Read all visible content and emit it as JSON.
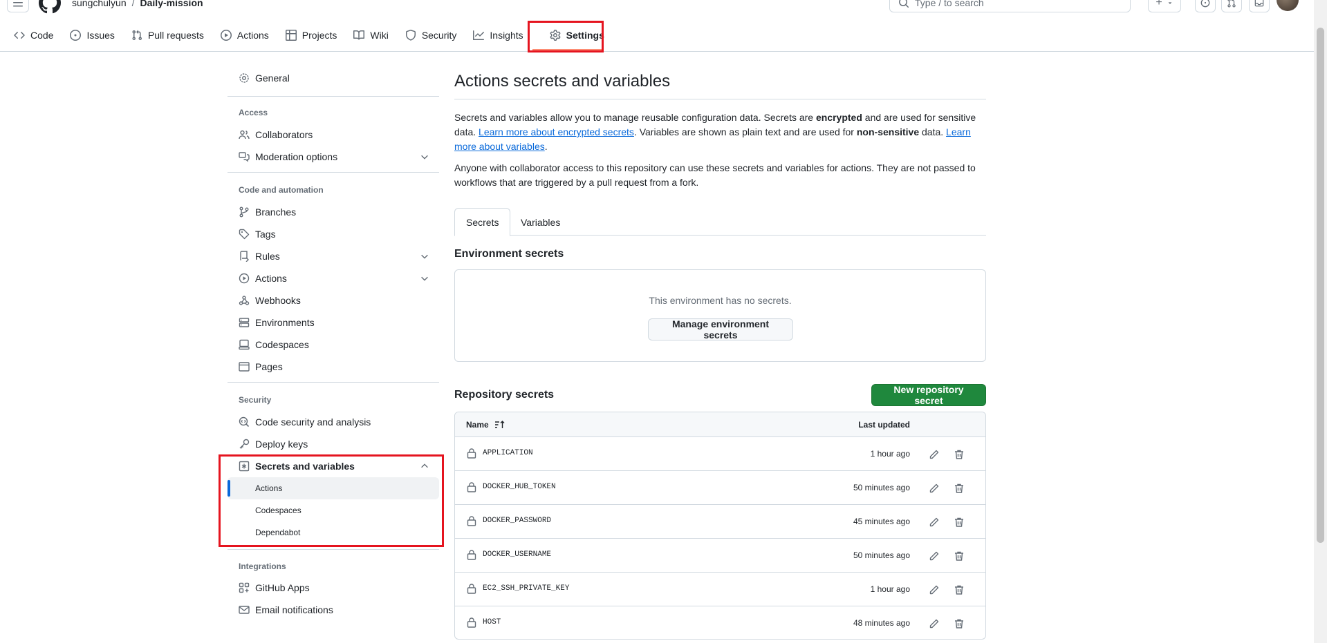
{
  "header": {
    "owner": "sungchulyun",
    "separator": "/",
    "repo": "Daily-mission",
    "search_placeholder": "Type / to search",
    "plus_label": "+"
  },
  "repo_nav": {
    "items": [
      {
        "label": "Code",
        "icon": "code-icon"
      },
      {
        "label": "Issues",
        "icon": "issue-icon"
      },
      {
        "label": "Pull requests",
        "icon": "pull-request-icon"
      },
      {
        "label": "Actions",
        "icon": "play-icon"
      },
      {
        "label": "Projects",
        "icon": "table-icon"
      },
      {
        "label": "Wiki",
        "icon": "book-icon"
      },
      {
        "label": "Security",
        "icon": "shield-icon"
      },
      {
        "label": "Insights",
        "icon": "graph-icon"
      },
      {
        "label": "Settings",
        "icon": "gear-icon"
      }
    ],
    "active": "Settings"
  },
  "sidebar": {
    "general": "General",
    "access_heading": "Access",
    "collaborators": "Collaborators",
    "moderation": "Moderation options",
    "code_heading": "Code and automation",
    "branches": "Branches",
    "tags": "Tags",
    "rules": "Rules",
    "actions": "Actions",
    "webhooks": "Webhooks",
    "environments": "Environments",
    "codespaces": "Codespaces",
    "pages": "Pages",
    "security_heading": "Security",
    "code_security": "Code security and analysis",
    "deploy_keys": "Deploy keys",
    "secrets_vars": "Secrets and variables",
    "sub_actions": "Actions",
    "sub_codespaces": "Codespaces",
    "sub_dependabot": "Dependabot",
    "integrations_heading": "Integrations",
    "github_apps": "GitHub Apps",
    "email_notifications": "Email notifications"
  },
  "main": {
    "title": "Actions secrets and variables",
    "p1": {
      "a": "Secrets and variables allow you to manage reusable configuration data. Secrets are ",
      "b": "encrypted",
      "c": " and are used for sensitive data. ",
      "link1": "Learn more about encrypted secrets",
      "d": ". Variables are shown as plain text and are used for ",
      "e": "non-sensitive",
      "f": " data. ",
      "link2": "Learn more about variables",
      "g": "."
    },
    "p2": "Anyone with collaborator access to this repository can use these secrets and variables for actions. They are not passed to workflows that are triggered by a pull request from a fork.",
    "tab_secrets": "Secrets",
    "tab_variables": "Variables",
    "env_heading": "Environment secrets",
    "env_empty": "This environment has no secrets.",
    "env_button": "Manage environment secrets",
    "repo_heading": "Repository secrets",
    "new_secret_button": "New repository secret",
    "col_name": "Name",
    "col_updated": "Last updated",
    "secrets": [
      {
        "name": "APPLICATION",
        "updated": "1 hour ago"
      },
      {
        "name": "DOCKER_HUB_TOKEN",
        "updated": "50 minutes ago"
      },
      {
        "name": "DOCKER_PASSWORD",
        "updated": "45 minutes ago"
      },
      {
        "name": "DOCKER_USERNAME",
        "updated": "50 minutes ago"
      },
      {
        "name": "EC2_SSH_PRIVATE_KEY",
        "updated": "1 hour ago"
      },
      {
        "name": "HOST",
        "updated": "48 minutes ago"
      }
    ]
  },
  "colors": {
    "highlight_box": "#e5141f",
    "accent_blue": "#0969da",
    "primary_green": "#1f883d",
    "nav_underline": "#fd8c73"
  }
}
